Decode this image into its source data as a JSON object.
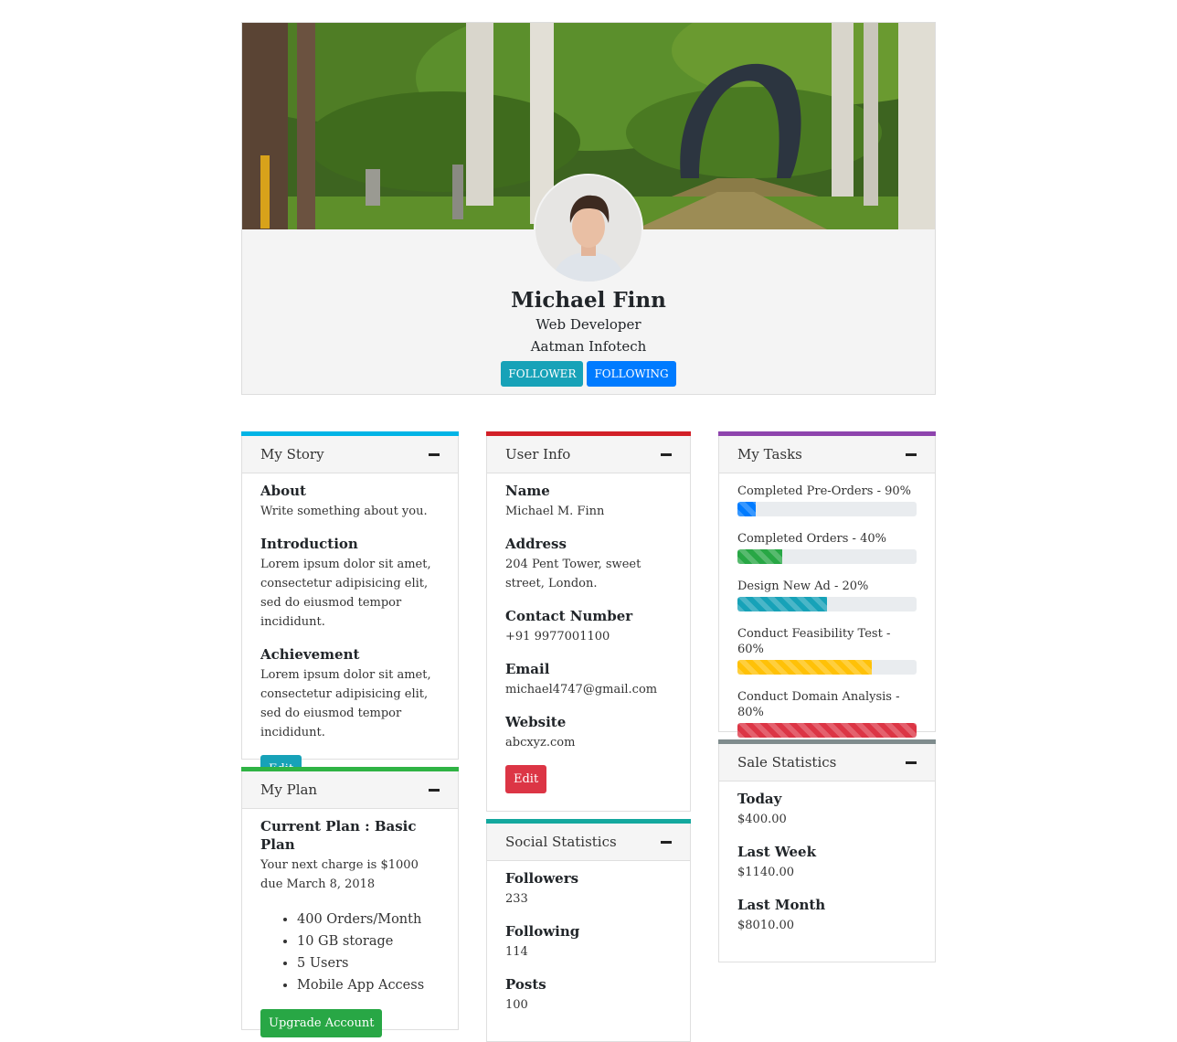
{
  "profile": {
    "name": "Michael Finn",
    "role": "Web Developer",
    "company": "Aatman Infotech",
    "follower_label": "FOLLOWER",
    "following_label": "FOLLOWING"
  },
  "story": {
    "title": "My Story",
    "about_label": "About",
    "about_text": "Write something about you.",
    "intro_label": "Introduction",
    "intro_text": "Lorem ipsum dolor sit amet, consectetur adipisicing elit, sed do eiusmod tempor incididunt.",
    "achievement_label": "Achievement",
    "achievement_text": "Lorem ipsum dolor sit amet, consectetur adipisicing elit, sed do eiusmod tempor incididunt.",
    "edit_label": "Edit"
  },
  "plan": {
    "title": "My Plan",
    "current": "Current Plan : Basic Plan",
    "charge": "Your next charge is $1000 due March 8, 2018",
    "features": [
      "400 Orders/Month",
      "10 GB storage",
      "5 Users",
      "Mobile App Access"
    ],
    "upgrade_label": "Upgrade Account"
  },
  "user_info": {
    "title": "User Info",
    "name_label": "Name",
    "name_value": "Michael M. Finn",
    "address_label": "Address",
    "address_value": "204 Pent Tower, sweet street, London.",
    "contact_label": "Contact Number",
    "contact_value": "+91 9977001100",
    "email_label": "Email",
    "email_value": "michael4747@gmail.com",
    "website_label": "Website",
    "website_value": "abcxyz.com",
    "edit_label": "Edit"
  },
  "social": {
    "title": "Social Statistics",
    "followers_label": "Followers",
    "followers_value": "233",
    "following_label": "Following",
    "following_value": "114",
    "posts_label": "Posts",
    "posts_value": "100"
  },
  "tasks": {
    "title": "My Tasks",
    "items": [
      {
        "label": "Completed Pre-Orders - 90%",
        "progress": 0.1,
        "color": "#007bff"
      },
      {
        "label": "Completed Orders - 40%",
        "progress": 0.25,
        "color": "#28a745"
      },
      {
        "label": "Design New Ad - 20%",
        "progress": 0.5,
        "color": "#17a2b8"
      },
      {
        "label": "Conduct Feasibility Test - 60%",
        "progress": 0.75,
        "color": "#ffc107"
      },
      {
        "label": "Conduct Domain Analysis - 80%",
        "progress": 1.0,
        "color": "#dc3545"
      }
    ]
  },
  "sales": {
    "title": "Sale Statistics",
    "today_label": "Today",
    "today_value": "$400.00",
    "week_label": "Last Week",
    "week_value": "$1140.00",
    "month_label": "Last Month",
    "month_value": "$8010.00"
  },
  "colors": {
    "story_accent": "#00b4e6",
    "plan_accent": "#2fb344",
    "user_info_accent": "#d22027",
    "social_accent": "#13a89e",
    "tasks_accent": "#8e44ad",
    "sales_accent": "#7f8c8d"
  },
  "icons": {
    "collapse": "minus-icon",
    "avatar": "user-photo"
  }
}
